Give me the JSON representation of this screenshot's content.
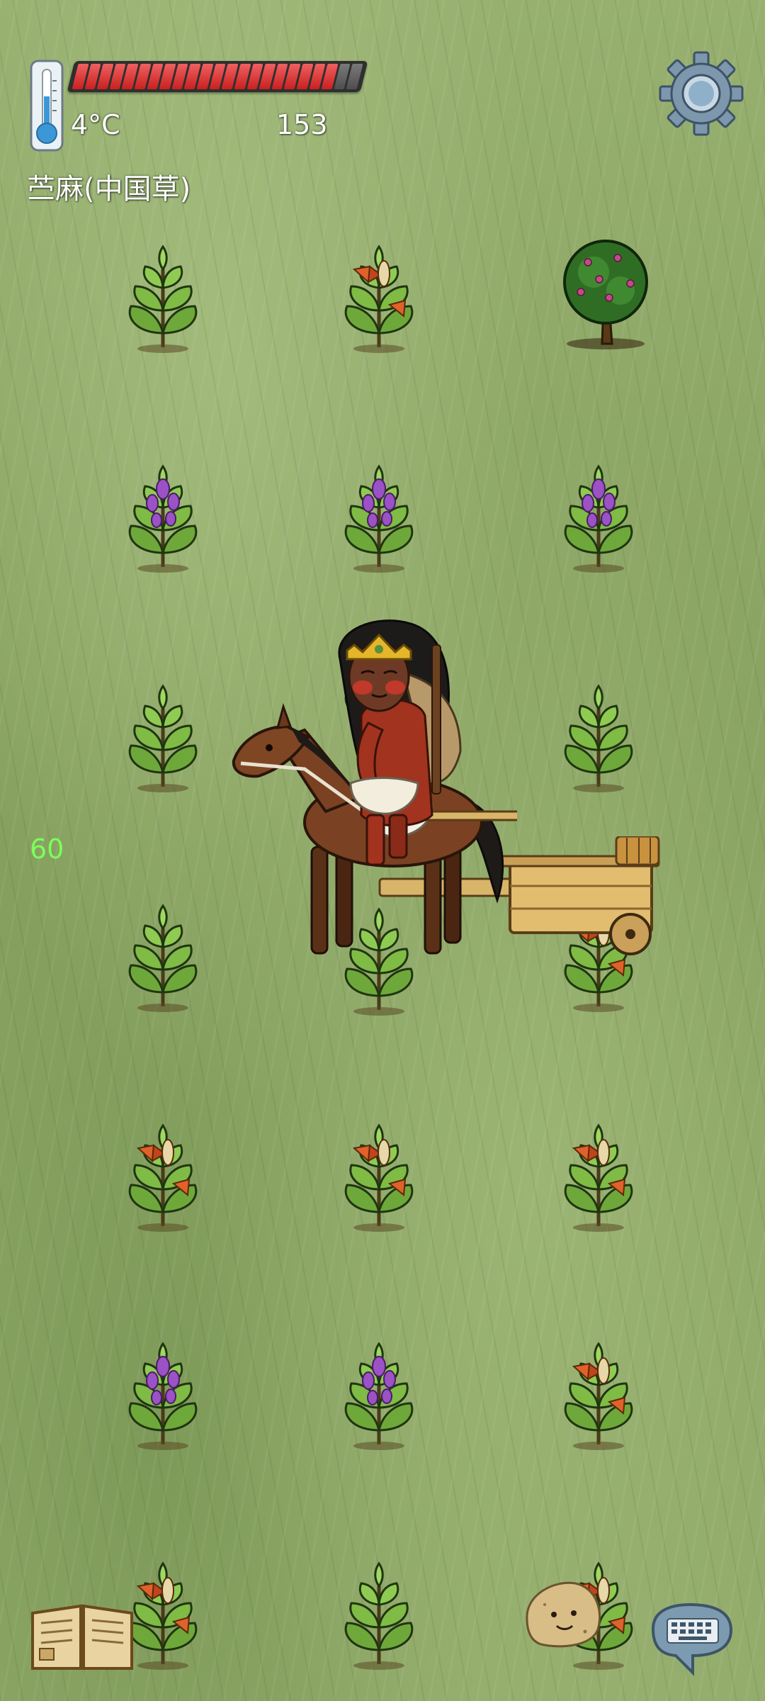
{
  "hud": {
    "temperature": "4°C",
    "food_counter": "153",
    "object_name": "苎麻(中国草)",
    "age": "60",
    "food_bar": {
      "filled": 21,
      "total": 23,
      "fill_color": "#d9302f",
      "empty_color": "#5a5a5a"
    }
  },
  "icons": {
    "thermometer": "thermometer-icon",
    "settings": "gear-icon",
    "tech_tree": "book-icon",
    "emote": "potato-face-icon",
    "chat": "keyboard-speech-icon"
  },
  "scene": {
    "plants": [
      {
        "type": "ramie-young"
      },
      {
        "type": "ramie-seeding"
      },
      {
        "type": "berry-tree"
      },
      {
        "type": "ramie-flowering"
      },
      {
        "type": "ramie-flowering"
      },
      {
        "type": "ramie-flowering"
      },
      {
        "type": "ramie-young"
      },
      {
        "type": "ramie-young"
      },
      {
        "type": "ramie-young"
      },
      {
        "type": "ramie-young"
      },
      {
        "type": "ramie-young"
      },
      {
        "type": "ramie-seeding"
      },
      {
        "type": "ramie-seeding"
      },
      {
        "type": "ramie-seeding"
      },
      {
        "type": "ramie-seeding"
      },
      {
        "type": "ramie-flowering"
      },
      {
        "type": "ramie-flowering"
      },
      {
        "type": "ramie-seeding"
      },
      {
        "type": "ramie-seeding"
      },
      {
        "type": "ramie-young"
      },
      {
        "type": "ramie-seeding"
      }
    ],
    "player": "woman-with-crown",
    "mount": "horse-with-cart"
  }
}
